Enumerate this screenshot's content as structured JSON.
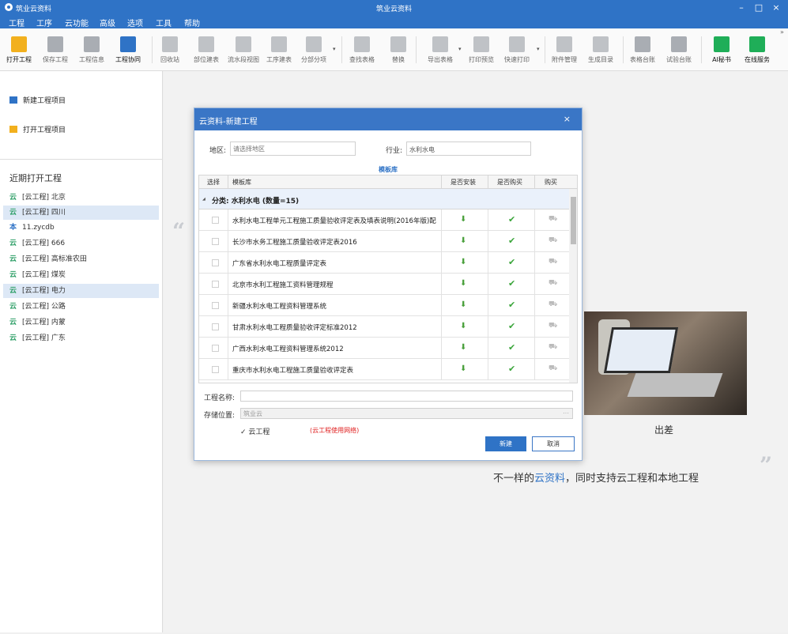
{
  "window": {
    "app_title": "筑业云资料",
    "title": "筑业云资料",
    "minimize": "–",
    "maximize": "□",
    "close": "×"
  },
  "menu": [
    "工程",
    "工序",
    "云功能",
    "高级",
    "选项",
    "工具",
    "帮助"
  ],
  "toolbar": {
    "items": [
      {
        "label": "打开工程",
        "color": "#f2b01e"
      },
      {
        "label": "保存工程",
        "color": "#a9adb3"
      },
      {
        "label": "工程信息",
        "color": "#a9adb3"
      },
      {
        "label": "工程协同",
        "color": "#2f73c6"
      },
      {
        "label": "回收站",
        "color": "#bfc2c6"
      },
      {
        "label": "部位建表",
        "color": "#bfc2c6"
      },
      {
        "label": "流水段视图",
        "color": "#bfc2c6"
      },
      {
        "label": "工序建表",
        "color": "#bfc2c6"
      },
      {
        "label": "分部分项",
        "color": "#bfc2c6"
      },
      {
        "label": "查找表格",
        "color": "#bfc2c6"
      },
      {
        "label": "替换",
        "color": "#bfc2c6"
      },
      {
        "label": "导出表格",
        "color": "#bfc2c6"
      },
      {
        "label": "打印预览",
        "color": "#bfc2c6"
      },
      {
        "label": "快速打印",
        "color": "#bfc2c6"
      },
      {
        "label": "附件管理",
        "color": "#bfc2c6"
      },
      {
        "label": "生成目录",
        "color": "#bfc2c6"
      },
      {
        "label": "表格台账",
        "color": "#a9adb3"
      },
      {
        "label": "试验台账",
        "color": "#a9adb3"
      },
      {
        "label": "AI秘书",
        "color": "#1fae58"
      },
      {
        "label": "在线服务",
        "color": "#1fae58"
      }
    ],
    "more": "»",
    "dropdown_arrow": "▾"
  },
  "sidebar": {
    "new_project": "新建工程项目",
    "open_project": "打开工程项目",
    "recent_title": "近期打开工程",
    "recent": [
      {
        "type": "云",
        "name": "[云工程] 北京"
      },
      {
        "type": "云",
        "name": "[云工程] 四川"
      },
      {
        "type": "本",
        "name": "11.zycdb"
      },
      {
        "type": "云",
        "name": "[云工程] 666"
      },
      {
        "type": "云",
        "name": "[云工程] 高标准农田"
      },
      {
        "type": "云",
        "name": "[云工程] 煤炭"
      },
      {
        "type": "云",
        "name": "[云工程] 电力"
      },
      {
        "type": "云",
        "name": "[云工程] 公路"
      },
      {
        "type": "云",
        "name": "[云工程] 内蒙"
      },
      {
        "type": "云",
        "name": "[云工程] 广东"
      }
    ]
  },
  "main": {
    "quote_open": "“",
    "quote_close": "”",
    "photo_caption": "出差",
    "slogan_pre": "不一样的",
    "slogan_hl": "云资料",
    "slogan_post": "，同时支持云工程和本地工程"
  },
  "dialog": {
    "title": "云资料-新建工程",
    "close": "×",
    "region_label": "地区:",
    "region_placeholder": "请选择地区",
    "industry_label": "行业:",
    "industry_value": "水利水电",
    "table_caption": "模板库",
    "columns": [
      "选择",
      "模板库",
      "是否安装",
      "是否购买",
      "购买"
    ],
    "group_label": "分类: 水利水电 (数量=15)",
    "group_toggle": "◢",
    "rows": [
      "水利水电工程单元工程施工质量验收评定表及填表说明(2016年版)配...",
      "长沙市水务工程施工质量验收评定表2016",
      "广东省水利水电工程质量评定表",
      "北京市水利工程施工资料管理规程",
      "新疆水利水电工程资料管理系统",
      "甘肃水利水电工程质量验收评定标准2012",
      "广西水利水电工程资料管理系统2012",
      "重庆市水利水电工程施工质量验收评定表"
    ],
    "installed_icon": "⬇",
    "bought_icon": "✔",
    "cart_icon": "⛟",
    "project_name_label": "工程名称:",
    "project_name_value": "",
    "storage_label": "存储位置:",
    "storage_value": "筑业云",
    "storage_more": "···",
    "cloud_checkbox": "✓ 云工程",
    "cloud_note": "(云工程使用网络)",
    "btn_new": "新建",
    "btn_cancel": "取消"
  }
}
